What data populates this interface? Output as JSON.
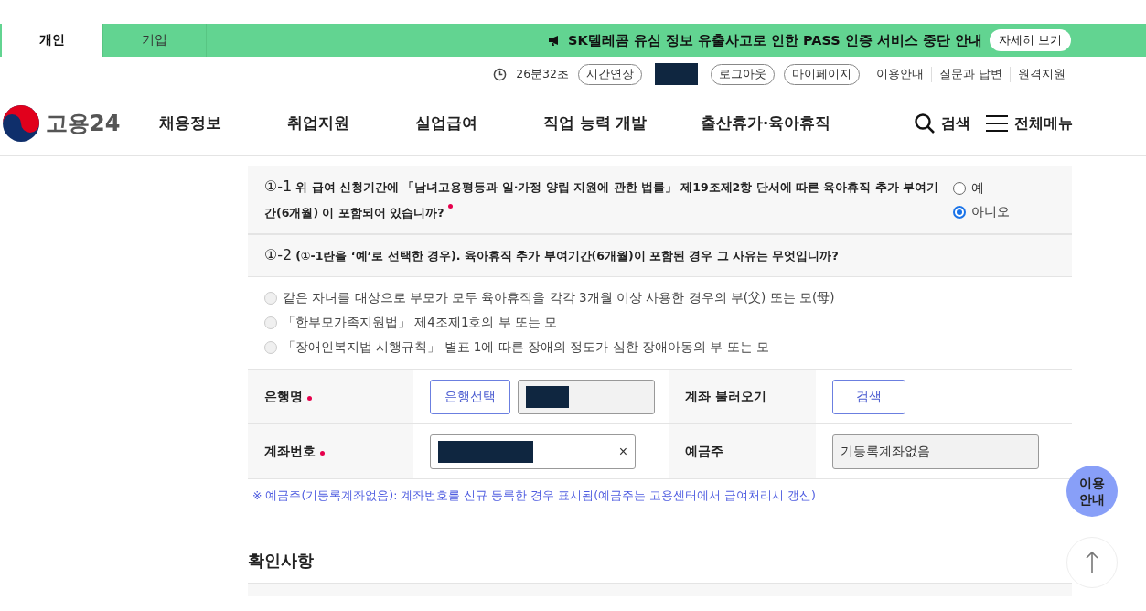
{
  "header": {
    "tabs": [
      {
        "label": "개인",
        "selected": true
      },
      {
        "label": "기업",
        "selected": false
      }
    ],
    "notice": {
      "text": "SK텔레콤 유심 정보 유출사고로 인한 PASS 인증 서비스 중단 안내",
      "button": "자세히 보기"
    }
  },
  "util": {
    "timer": "26분32초",
    "extend": "시간연장",
    "logout": "로그아웃",
    "mypage": "마이페이지",
    "links": [
      "이용안내",
      "질문과 답변",
      "원격지원"
    ]
  },
  "nav": {
    "logo": "고용24",
    "items": [
      "채용정보",
      "취업지원",
      "실업급여",
      "직업 능력 개발",
      "출산휴가·육아휴직"
    ],
    "search": "검색",
    "menu": "전체메뉴"
  },
  "questions": [
    {
      "number": "①-1",
      "text": "위 급여 신청기간에 「남녀고용평등과 일·가정 양립 지원에 관한 법률」 제19조제2항 단서에 따른 육아휴직 추가 부여기간(6개월) 이 포함되어 있습니까?",
      "required": true,
      "options": [
        {
          "label": "예",
          "selected": false
        },
        {
          "label": "아니오",
          "selected": true
        }
      ]
    },
    {
      "number": "①-2",
      "text": "(①-1란을 ‘예’로 선택한 경우). 육아휴직 추가 부여기간(6개월)이 포함된 경우 그 사유는 무엇입니까?",
      "options": [
        {
          "label": "같은 자녀를 대상으로 부모가 모두 육아휴직을 각각 3개월 이상 사용한 경우의 부(父) 또는 모(母)",
          "selected": false,
          "disabled": true
        },
        {
          "label": "「한부모가족지원법」 제4조제1호의 부 또는 모",
          "selected": false,
          "disabled": true
        },
        {
          "label": "「장애인복지법 시행규칙」 별표 1에 따른 장애의 정도가 심한 장애아동의 부 또는 모",
          "selected": false,
          "disabled": true
        }
      ]
    }
  ],
  "account": {
    "rows": [
      {
        "label": "은행명",
        "required": true,
        "button": "은행선택",
        "label2": "계좌 불러오기",
        "button2": "검색"
      },
      {
        "label": "계좌번호",
        "required": true,
        "clear": "×",
        "label2": "예금주",
        "value2": "기등록계좌없음"
      }
    ],
    "note": "※ 예금주(기등록계좌없음): 계좌번호를 신규 등록한 경우 표시됨(예금주는 고용센터에서 급여처리시 갱신)"
  },
  "section_title": "확인사항",
  "floating": {
    "guide": "이용 안내"
  }
}
